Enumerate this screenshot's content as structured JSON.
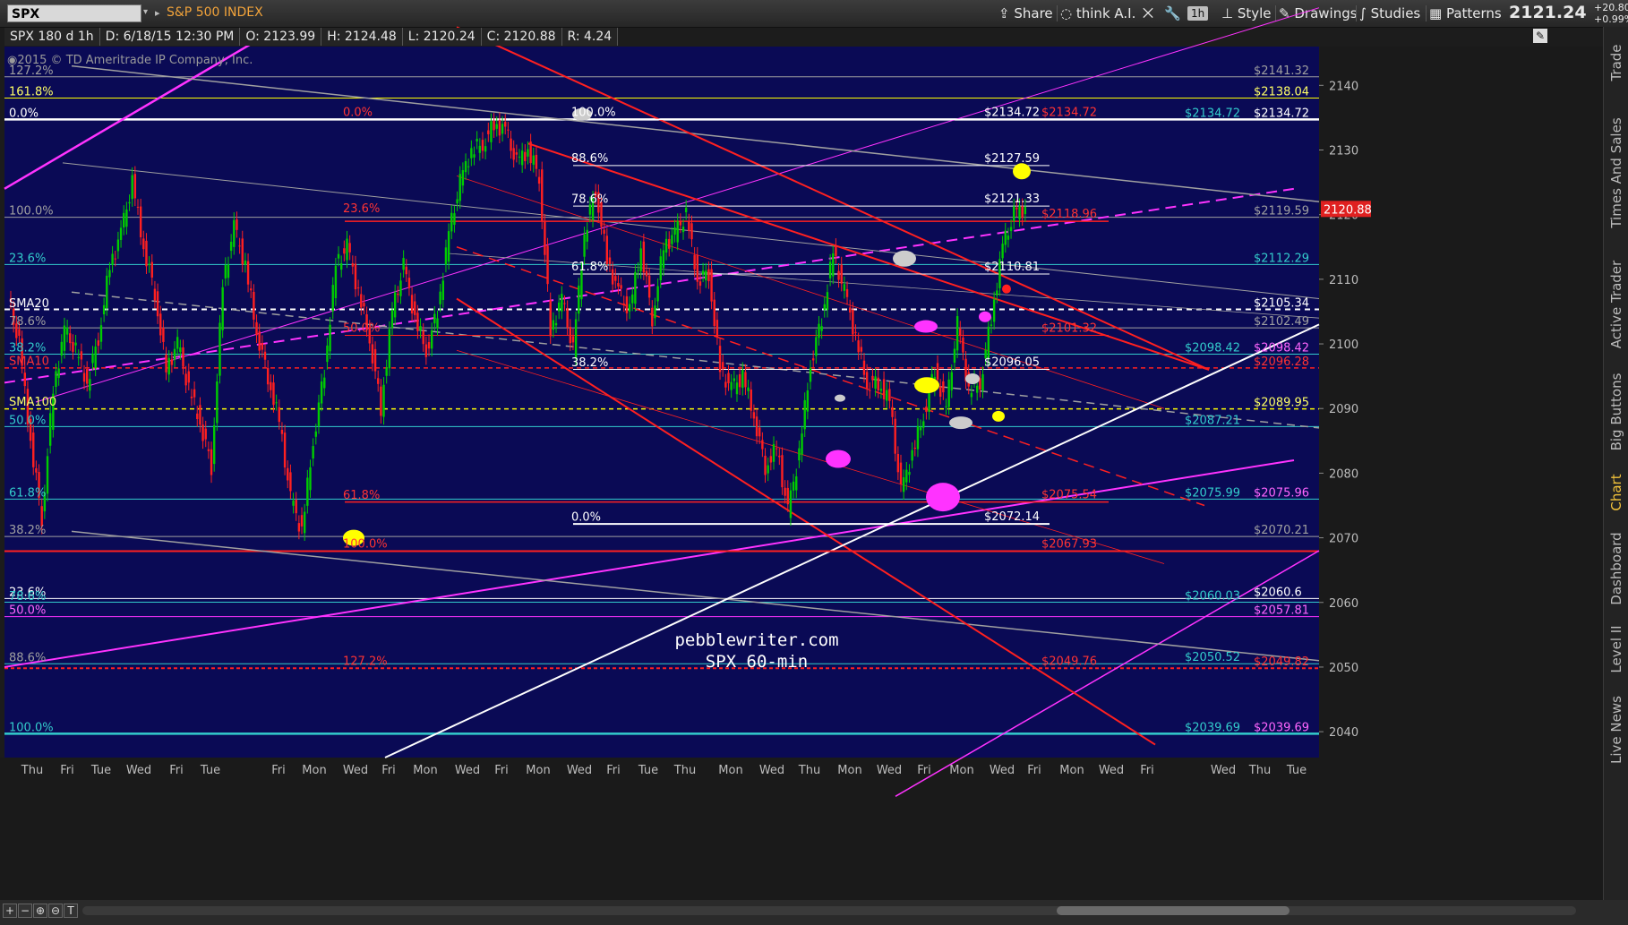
{
  "toolbar": {
    "symbol": "SPX",
    "instrument_name": "S&P 500 INDEX",
    "share_label": "Share",
    "think_ai_label": "think A.I.",
    "timeframe_label": "1h",
    "style_label": "Style",
    "drawings_label": "Drawings",
    "studies_label": "Studies",
    "patterns_label": "Patterns",
    "last_price": "2121.24",
    "change": "+20.80",
    "change_pct": "+0.99%"
  },
  "infobar": {
    "period": "SPX 180 d 1h",
    "date": "D: 6/18/15 12:30 PM",
    "open": "O: 2123.99",
    "high": "H: 2124.48",
    "low": "L: 2120.24",
    "close": "C: 2120.88",
    "range": "R: 4.24"
  },
  "copyright": "2015 © TD Ameritrade IP Company, Inc.",
  "right_tabs": [
    "Trade",
    "Times And Sales",
    "Active Trader",
    "Big Buttons",
    "Chart",
    "Dashboard",
    "Level II",
    "Live News"
  ],
  "colors": {
    "background": "#0a0a55",
    "up_candle": "#00cc00",
    "down_candle": "#ff2020",
    "channel_red": "#ff2020",
    "magenta": "#ff33ff",
    "cyan": "#33cccc",
    "grey": "#a0a0a0",
    "white": "#ffffff",
    "yellow": "#ffff00"
  },
  "watermark": {
    "line1": "pebblewriter.com",
    "line2": "SPX 60-min"
  },
  "chart_data": {
    "type": "line",
    "title": "SPX",
    "ylim": [
      2036,
      2146
    ],
    "y_ticks": [
      2040,
      2050,
      2060,
      2070,
      2080,
      2090,
      2100,
      2110,
      2120,
      2130,
      2140
    ],
    "x_labels": [
      "Thu",
      "Fri",
      "Tue",
      "Wed",
      "Fri",
      "Tue",
      "Fri",
      "Mon",
      "Wed",
      "Fri",
      "Mon",
      "Wed",
      "Fri",
      "Mon",
      "Wed",
      "Fri",
      "Tue",
      "Thu",
      "Mon",
      "Wed",
      "Thu",
      "Mon",
      "Wed",
      "Fri",
      "Mon",
      "Wed",
      "Fri",
      "Mon",
      "Wed",
      "Fri",
      "Wed",
      "Thu",
      "Tue"
    ],
    "current_price_label": "2120.88",
    "series": [
      {
        "values": [
          2107,
          2100,
          2085,
          2073,
          2093,
          2102,
          2099,
          2094,
          2101,
          2112,
          2117,
          2125,
          2115,
          2108,
          2096,
          2100,
          2093,
          2088,
          2081,
          2109,
          2118,
          2112,
          2102,
          2095,
          2088,
          2076,
          2071,
          2085,
          2096,
          2112,
          2115,
          2108,
          2101,
          2090,
          2105,
          2112,
          2104,
          2099,
          2105,
          2117,
          2125,
          2130,
          2131,
          2134,
          2133,
          2128,
          2130,
          2126,
          2102,
          2107,
          2099,
          2117,
          2124,
          2113,
          2108,
          2105,
          2115,
          2104,
          2115,
          2117,
          2120,
          2110,
          2111,
          2096,
          2093,
          2095,
          2089,
          2081,
          2084,
          2074,
          2083,
          2097,
          2104,
          2114,
          2108,
          2101,
          2094,
          2094,
          2091,
          2077,
          2083,
          2089,
          2096,
          2090,
          2103,
          2093,
          2094,
          2104,
          2115,
          2120,
          2121
        ]
      }
    ],
    "right_labels": [
      {
        "text": "$2141.32",
        "color": "#a0a0a0",
        "price": 2141.32
      },
      {
        "text": "$2138.04",
        "color": "#ffff66",
        "price": 2138.04
      },
      {
        "text": "$2134.72",
        "color": "#ffffff",
        "price": 2134.72
      },
      {
        "text": "$2119.59",
        "color": "#a0a0a0",
        "price": 2119.59
      },
      {
        "text": "$2112.29",
        "color": "#33cccc",
        "price": 2112.29
      },
      {
        "text": "$2105.34",
        "color": "#ffffff",
        "price": 2105.34
      },
      {
        "text": "$2102.49",
        "color": "#a0a0a0",
        "price": 2102.49
      },
      {
        "text": "$2098.42",
        "color": "#ff66ff",
        "price": 2098.42
      },
      {
        "text": "$2096.28",
        "color": "#ff3333",
        "price": 2096.28
      },
      {
        "text": "$2089.95",
        "color": "#ffff66",
        "price": 2089.95
      },
      {
        "text": "$2075.96",
        "color": "#ff66ff",
        "price": 2075.96
      },
      {
        "text": "$2070.21",
        "color": "#a0a0a0",
        "price": 2070.21
      },
      {
        "text": "$2060.6",
        "color": "#ffffff",
        "price": 2060.6
      },
      {
        "text": "$2057.81",
        "color": "#ff66ff",
        "price": 2057.81
      },
      {
        "text": "$2049.82",
        "color": "#ff3333",
        "price": 2049.82
      },
      {
        "text": "$2039.69",
        "color": "#ff66ff",
        "price": 2039.69
      }
    ],
    "mid_labels": [
      {
        "text": "$2134.72",
        "color": "#33cccc",
        "price": 2134.72
      },
      {
        "text": "$2098.42",
        "color": "#33cccc",
        "price": 2098.42
      },
      {
        "text": "$2087.21",
        "color": "#33cccc",
        "price": 2087.21
      },
      {
        "text": "$2075.99",
        "color": "#33cccc",
        "price": 2075.99
      },
      {
        "text": "$2060.03",
        "color": "#33cccc",
        "price": 2060.03
      },
      {
        "text": "$2050.52",
        "color": "#33cccc",
        "price": 2050.52
      },
      {
        "text": "$2039.69",
        "color": "#33cccc",
        "price": 2039.69
      }
    ],
    "fib_white_labels": [
      {
        "text": "100.0%",
        "price": 2134.72
      },
      {
        "text": "88.6%",
        "price": 2127.6
      },
      {
        "text": "78.6%",
        "price": 2121.3
      },
      {
        "text": "61.8%",
        "price": 2110.8
      },
      {
        "text": "38.2%",
        "price": 2096.0
      },
      {
        "text": "0.0%",
        "price": 2072.1
      }
    ],
    "fib_white_price_labels": [
      {
        "text": "$2134.72",
        "price": 2134.72
      },
      {
        "text": "$2127.59",
        "price": 2127.59
      },
      {
        "text": "$2121.33",
        "price": 2121.33
      },
      {
        "text": "$2110.81",
        "price": 2110.81
      },
      {
        "text": "$2096.05",
        "price": 2096.05
      },
      {
        "text": "$2072.14",
        "price": 2072.14
      }
    ],
    "fib_red_labels": [
      {
        "text": "0.0%",
        "price": 2134.72
      },
      {
        "text": "23.6%",
        "price": 2119.8
      },
      {
        "text": "50.0%",
        "price": 2101.3
      },
      {
        "text": "61.8%",
        "price": 2075.5
      },
      {
        "text": "100.0%",
        "price": 2067.9
      },
      {
        "text": "127.2%",
        "price": 2049.8
      }
    ],
    "fib_red_price_labels": [
      {
        "text": "$2134.72",
        "price": 2134.72
      },
      {
        "text": "$2118.96",
        "price": 2118.96
      },
      {
        "text": "$2101.32",
        "price": 2101.32
      },
      {
        "text": "$2075.54",
        "price": 2075.54
      },
      {
        "text": "$2067.93",
        "price": 2067.93
      },
      {
        "text": "$2049.76",
        "price": 2049.76
      }
    ],
    "left_labels": [
      {
        "text": "127.2%",
        "color": "#a0a0a0",
        "price": 2141.3
      },
      {
        "text": "161.8%",
        "color": "#ffff66",
        "price": 2138.0
      },
      {
        "text": "0.0%",
        "color": "#ffffff",
        "price": 2134.7
      },
      {
        "text": "100.0%",
        "color": "#a0a0a0",
        "price": 2119.6
      },
      {
        "text": "23.6%",
        "color": "#33cccc",
        "price": 2112.3
      },
      {
        "text": "SMA20",
        "color": "#ffffff",
        "price": 2105.3
      },
      {
        "text": "78.6%",
        "color": "#a0a0a0",
        "price": 2102.5
      },
      {
        "text": "38.2%",
        "color": "#33cccc",
        "price": 2098.4
      },
      {
        "text": "SMA10",
        "color": "#ff3333",
        "price": 2096.3
      },
      {
        "text": "SMA100",
        "color": "#ffff66",
        "price": 2090.0
      },
      {
        "text": "50.0%",
        "color": "#33cccc",
        "price": 2087.2
      },
      {
        "text": "61.8%",
        "color": "#33cccc",
        "price": 2076.0
      },
      {
        "text": "38.2%",
        "color": "#a0a0a0",
        "price": 2070.2
      },
      {
        "text": "23.6%",
        "color": "#ffffff",
        "price": 2060.6
      },
      {
        "text": "78.6%",
        "color": "#33cccc",
        "price": 2060.0
      },
      {
        "text": "50.0%",
        "color": "#ff66ff",
        "price": 2057.8
      },
      {
        "text": "88.6%",
        "color": "#a0a0a0",
        "price": 2050.5
      },
      {
        "text": "100.0%",
        "color": "#33cccc",
        "price": 2039.7
      }
    ]
  }
}
